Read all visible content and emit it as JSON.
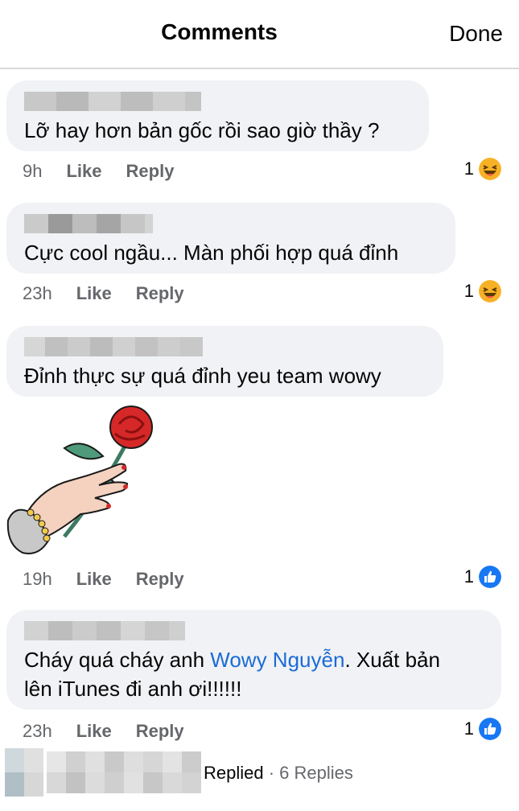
{
  "header": {
    "title": "Comments",
    "done_label": "Done"
  },
  "comments": [
    {
      "text": "Lỡ hay hơn bản gốc rồi sao giờ thầy ?",
      "time": "9h",
      "like": "Like",
      "reply": "Reply",
      "reaction_count": "1",
      "reaction_icon": "haha-emoji-icon"
    },
    {
      "text": "Cực cool ngầu... Màn phối hợp quá đỉnh",
      "time": "23h",
      "like": "Like",
      "reply": "Reply",
      "reaction_count": "1",
      "reaction_icon": "haha-emoji-icon"
    },
    {
      "text": "Đỉnh  thực sự quá đỉnh yeu team wowy",
      "time": "19h",
      "like": "Like",
      "reply": "Reply",
      "reaction_count": "1",
      "reaction_icon": "like-thumb-icon",
      "sticker": "hand-holding-rose-sticker"
    },
    {
      "text_before": "Cháy quá cháy anh ",
      "mention": "Wowy Nguyễn",
      "text_after": ". Xuất bản",
      "text_line2": "lên iTunes đi anh ơi!!!!!!",
      "time": "23h",
      "like": "Like",
      "reply": "Reply",
      "reaction_count": "1",
      "reaction_icon": "like-thumb-icon"
    }
  ],
  "replies": {
    "replied": "Replied",
    "separator": " · ",
    "count_label": "6 Replies"
  },
  "colors": {
    "bubble": "#f0f2f5",
    "meta": "#65676b",
    "link": "#1b6bd6",
    "like_blue": "#1877f2",
    "haha_yellow": "#f7b125"
  }
}
